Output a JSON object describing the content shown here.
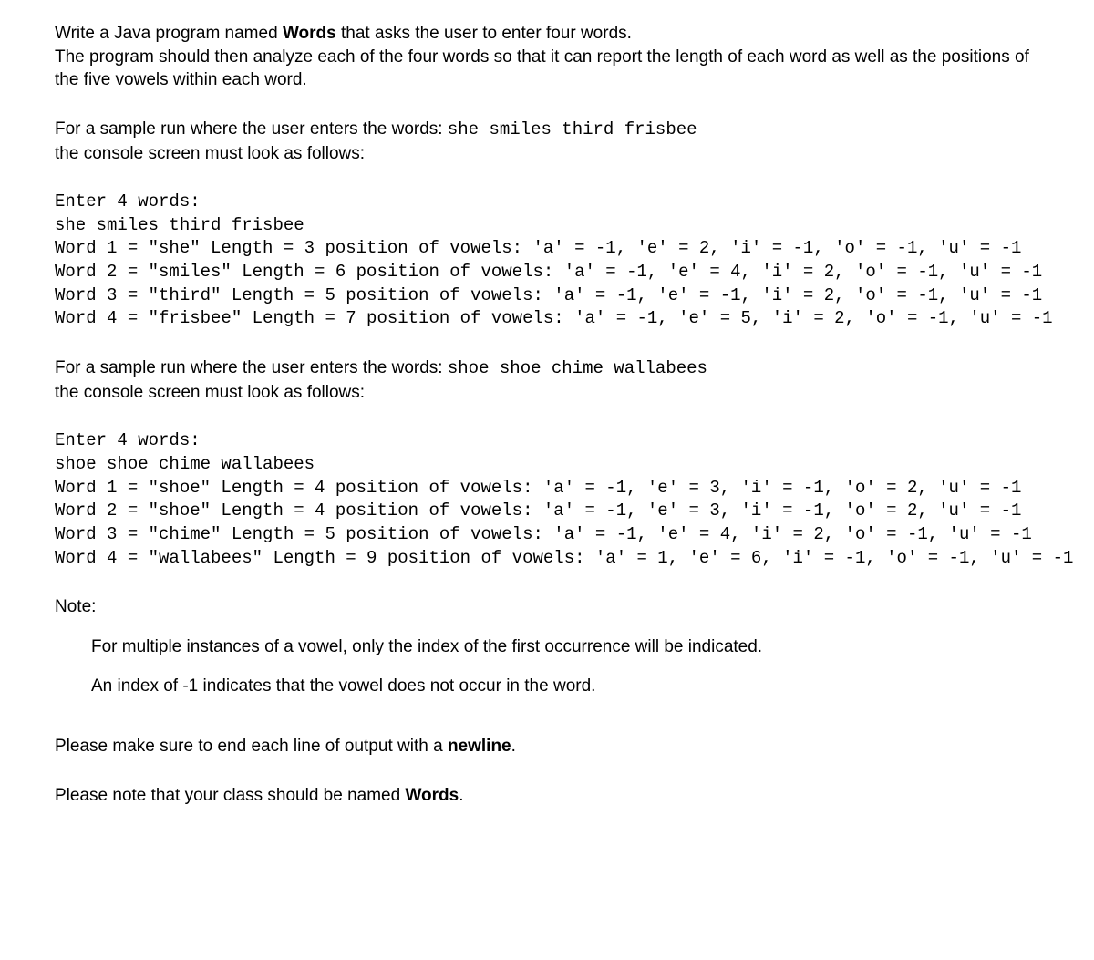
{
  "intro": {
    "line1_pre": "Write a Java program named ",
    "line1_bold": "Words",
    "line1_post": " that asks the user to enter four words.",
    "line2": "The program should then analyze each of the four words so that it can report the length of each word as well as the positions of the five vowels within each word."
  },
  "sample1": {
    "lead_pre": "For a sample run where the user enters the words: ",
    "lead_mono": "she smiles third frisbee",
    "follow": "the console screen must look as follows:",
    "console": "Enter 4 words:\nshe smiles third frisbee\nWord 1 = \"she\" Length = 3 position of vowels: 'a' = -1, 'e' = 2, 'i' = -1, 'o' = -1, 'u' = -1\nWord 2 = \"smiles\" Length = 6 position of vowels: 'a' = -1, 'e' = 4, 'i' = 2, 'o' = -1, 'u' = -1\nWord 3 = \"third\" Length = 5 position of vowels: 'a' = -1, 'e' = -1, 'i' = 2, 'o' = -1, 'u' = -1\nWord 4 = \"frisbee\" Length = 7 position of vowels: 'a' = -1, 'e' = 5, 'i' = 2, 'o' = -1, 'u' = -1"
  },
  "sample2": {
    "lead_pre": "For a sample run where the user enters the words: ",
    "lead_mono": "shoe shoe chime wallabees",
    "follow": "the console screen must look as follows:",
    "console": "Enter 4 words:\nshoe shoe chime wallabees\nWord 1 = \"shoe\" Length = 4 position of vowels: 'a' = -1, 'e' = 3, 'i' = -1, 'o' = 2, 'u' = -1\nWord 2 = \"shoe\" Length = 4 position of vowels: 'a' = -1, 'e' = 3, 'i' = -1, 'o' = 2, 'u' = -1\nWord 3 = \"chime\" Length = 5 position of vowels: 'a' = -1, 'e' = 4, 'i' = 2, 'o' = -1, 'u' = -1\nWord 4 = \"wallabees\" Length = 9 position of vowels: 'a' = 1, 'e' = 6, 'i' = -1, 'o' = -1, 'u' = -1"
  },
  "note": {
    "heading": "Note:",
    "item1": "For multiple instances of a vowel, only the index of the first occurrence will be indicated.",
    "item2": "An index of -1 indicates that the vowel does not occur in the word."
  },
  "footer": {
    "line1_pre": "Please make sure to end each line of output with a ",
    "line1_bold": "newline",
    "line1_post": ".",
    "line2_pre": "Please note that your class should be named ",
    "line2_bold": "Words",
    "line2_post": "."
  }
}
